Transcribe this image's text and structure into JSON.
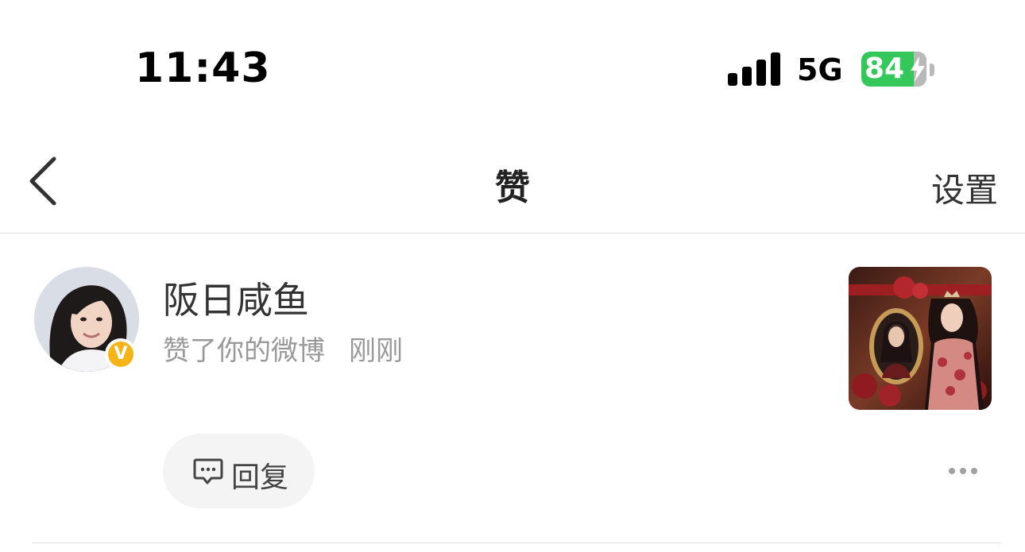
{
  "status_bar": {
    "time": "11:43",
    "network": "5G",
    "battery_level": "84",
    "battery_color": "#34c759"
  },
  "nav": {
    "back_icon": "chevron-left-icon",
    "title": "赞",
    "settings_label": "设置"
  },
  "notification": {
    "username": "阪日咸鱼",
    "action_text": "赞了你的微博",
    "time_ago": "刚刚",
    "verified_badge": "V",
    "verified_color": "#f5b518",
    "reply_label": "回复",
    "reply_icon": "comment-icon",
    "more_icon": "more-horizontal-icon"
  }
}
